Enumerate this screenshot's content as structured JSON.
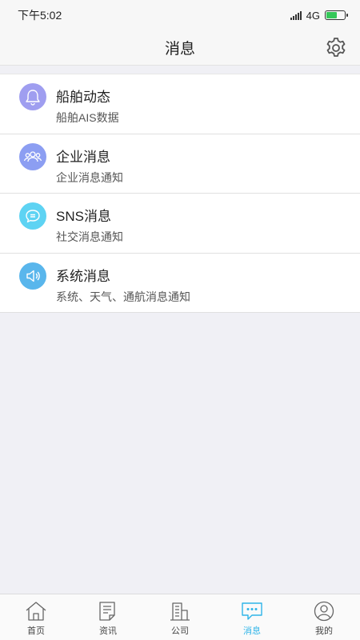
{
  "status_bar": {
    "time": "下午5:02",
    "network": "4G"
  },
  "header": {
    "title": "消息"
  },
  "messages": [
    {
      "title": "船舶动态",
      "subtitle": "船舶AIS数据",
      "icon": "bell-icon",
      "color": "#9f9ef0"
    },
    {
      "title": "企业消息",
      "subtitle": "企业消息通知",
      "icon": "group-icon",
      "color": "#8c9ef2"
    },
    {
      "title": "SNS消息",
      "subtitle": "社交消息通知",
      "icon": "chat-bubble-icon",
      "color": "#5ed3f3"
    },
    {
      "title": "系统消息",
      "subtitle": "系统、天气、通航消息通知",
      "icon": "speaker-icon",
      "color": "#59b6ec"
    }
  ],
  "tab_bar": {
    "active_index": 3,
    "active_color": "#2eb4e8",
    "items": [
      {
        "label": "首页",
        "icon": "home-icon"
      },
      {
        "label": "资讯",
        "icon": "news-icon"
      },
      {
        "label": "公司",
        "icon": "company-icon"
      },
      {
        "label": "消息",
        "icon": "message-icon"
      },
      {
        "label": "我的",
        "icon": "profile-icon"
      }
    ]
  }
}
